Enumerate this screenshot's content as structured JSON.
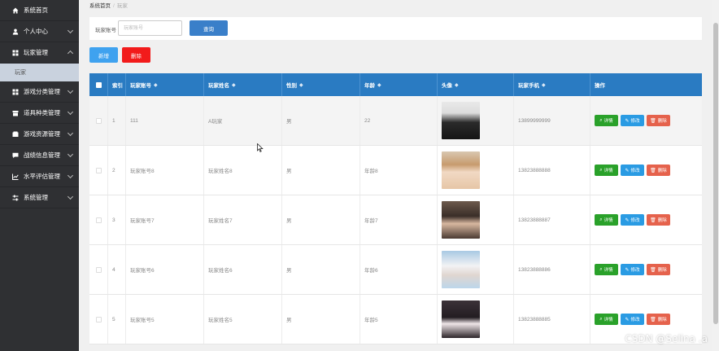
{
  "sidebar": {
    "items": [
      {
        "label": "系统首页",
        "icon": "home-icon",
        "chevron": false
      },
      {
        "label": "个人中心",
        "icon": "user-icon",
        "chevron": true
      },
      {
        "label": "玩家管理",
        "icon": "grid-icon",
        "chevron": true,
        "expanded": true
      },
      {
        "label": "游戏分类管理",
        "icon": "grid-icon",
        "chevron": true
      },
      {
        "label": "道具种类管理",
        "icon": "store-icon",
        "chevron": true
      },
      {
        "label": "游戏资源管理",
        "icon": "folder-icon",
        "chevron": true
      },
      {
        "label": "战绩信息管理",
        "icon": "chat-icon",
        "chevron": true
      },
      {
        "label": "水平评估管理",
        "icon": "chart-icon",
        "chevron": true
      },
      {
        "label": "系统管理",
        "icon": "sliders-icon",
        "chevron": true
      }
    ],
    "submenu_label": "玩家"
  },
  "breadcrumb": {
    "home": "系统首页",
    "current": "玩家"
  },
  "search": {
    "label": "玩家账号",
    "placeholder": "玩家账号",
    "button": "查询"
  },
  "toolbar": {
    "add": "新增",
    "delete": "删除"
  },
  "table": {
    "columns": [
      "索引",
      "玩家账号",
      "玩家姓名",
      "性别",
      "年龄",
      "头像",
      "玩家手机",
      "操作"
    ],
    "actions": {
      "detail": "详情",
      "edit": "修改",
      "delete": "删除"
    },
    "rows": [
      {
        "index": "1",
        "account": "111",
        "name": "A玩家",
        "gender": "男",
        "age": "22",
        "phone": "13899999999"
      },
      {
        "index": "2",
        "account": "玩家账号8",
        "name": "玩家姓名8",
        "gender": "男",
        "age": "年龄8",
        "phone": "13823888888"
      },
      {
        "index": "3",
        "account": "玩家账号7",
        "name": "玩家姓名7",
        "gender": "男",
        "age": "年龄7",
        "phone": "13823888887"
      },
      {
        "index": "4",
        "account": "玩家账号6",
        "name": "玩家姓名6",
        "gender": "男",
        "age": "年龄6",
        "phone": "13823888886"
      },
      {
        "index": "5",
        "account": "玩家账号5",
        "name": "玩家姓名5",
        "gender": "男",
        "age": "年龄5",
        "phone": "13823888885"
      }
    ]
  },
  "watermark": "CSDN @Selina .a",
  "colors": {
    "sidebar": "#2f3033",
    "header": "#2a7bc2",
    "detail": "#2aa12a",
    "edit": "#2a9be3",
    "delete": "#e5624c",
    "danger": "#f21b1b"
  }
}
